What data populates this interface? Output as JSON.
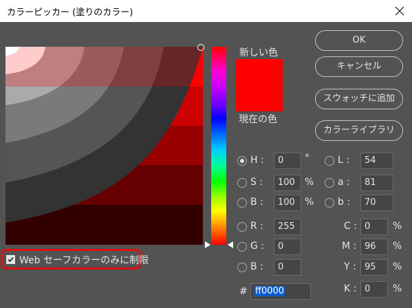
{
  "window": {
    "title": "カラーピッカー (塗りのカラー)"
  },
  "buttons": {
    "ok": "OK",
    "cancel": "キャンセル",
    "add_swatch": "スウォッチに追加",
    "color_library": "カラーライブラリ"
  },
  "preview": {
    "new_label": "新しい色",
    "current_label": "現在の色",
    "new_color": "#ff0000",
    "current_color": "#ff0000"
  },
  "hsb": {
    "h_label": "H :",
    "h_value": "0",
    "h_unit": "°",
    "s_label": "S :",
    "s_value": "100",
    "s_unit": "%",
    "b_label": "B :",
    "b_value": "100",
    "b_unit": "%"
  },
  "lab": {
    "l_label": "L :",
    "l_value": "54",
    "a_label": "a :",
    "a_value": "81",
    "b_label": "b :",
    "b_value": "70"
  },
  "rgb": {
    "r_label": "R :",
    "r_value": "255",
    "g_label": "G :",
    "g_value": "0",
    "b_label": "B :",
    "b_value": "0"
  },
  "cmyk": {
    "c_label": "C :",
    "c_value": "0",
    "m_label": "M :",
    "m_value": "96",
    "y_label": "Y :",
    "y_value": "95",
    "k_label": "K :",
    "k_value": "0",
    "unit": "%"
  },
  "hex": {
    "label": "#",
    "value": "ff0000"
  },
  "web_safe": {
    "label": "Web セーフカラーのみに制限",
    "checked": true
  },
  "selected_mode": "H",
  "colors": {
    "dialog_bg": "#535353",
    "accent_red": "#ff0000",
    "highlight_outline": "#e01010",
    "hex_selection": "#0b5cc8"
  }
}
